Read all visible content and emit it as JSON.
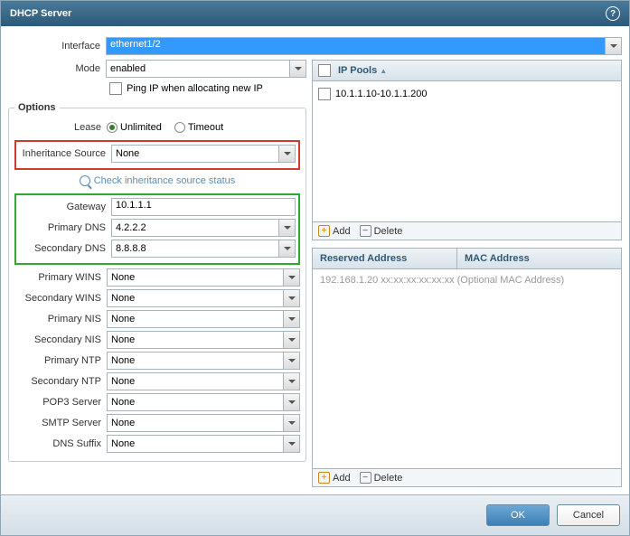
{
  "title": "DHCP Server",
  "interface": {
    "label": "Interface",
    "value": "ethernet1/2"
  },
  "mode": {
    "label": "Mode",
    "value": "enabled"
  },
  "ping_ip": {
    "label": "Ping IP when allocating new IP"
  },
  "options": {
    "legend": "Options",
    "lease": {
      "label": "Lease",
      "unlimited": "Unlimited",
      "timeout": "Timeout",
      "selected": "unlimited"
    },
    "inheritance": {
      "label": "Inheritance Source",
      "value": "None"
    },
    "check_link": "Check inheritance source status",
    "fields": {
      "gateway": {
        "label": "Gateway",
        "value": "10.1.1.1"
      },
      "primary_dns": {
        "label": "Primary DNS",
        "value": "4.2.2.2"
      },
      "secondary_dns": {
        "label": "Secondary DNS",
        "value": "8.8.8.8"
      },
      "primary_wins": {
        "label": "Primary WINS",
        "value": "None"
      },
      "secondary_wins": {
        "label": "Secondary WINS",
        "value": "None"
      },
      "primary_nis": {
        "label": "Primary NIS",
        "value": "None"
      },
      "secondary_nis": {
        "label": "Secondary NIS",
        "value": "None"
      },
      "primary_ntp": {
        "label": "Primary NTP",
        "value": "None"
      },
      "secondary_ntp": {
        "label": "Secondary NTP",
        "value": "None"
      },
      "pop3": {
        "label": "POP3 Server",
        "value": "None"
      },
      "smtp": {
        "label": "SMTP Server",
        "value": "None"
      },
      "dns_suffix": {
        "label": "DNS Suffix",
        "value": "None"
      }
    }
  },
  "ip_pools": {
    "header": "IP Pools",
    "rows": [
      "10.1.1.10-10.1.1.200"
    ]
  },
  "reserved": {
    "col1": "Reserved Address",
    "col2": "MAC Address",
    "placeholder": "192.168.1.20 xx:xx:xx:xx:xx:xx (Optional MAC Address)"
  },
  "actions": {
    "add": "Add",
    "delete": "Delete"
  },
  "buttons": {
    "ok": "OK",
    "cancel": "Cancel"
  }
}
